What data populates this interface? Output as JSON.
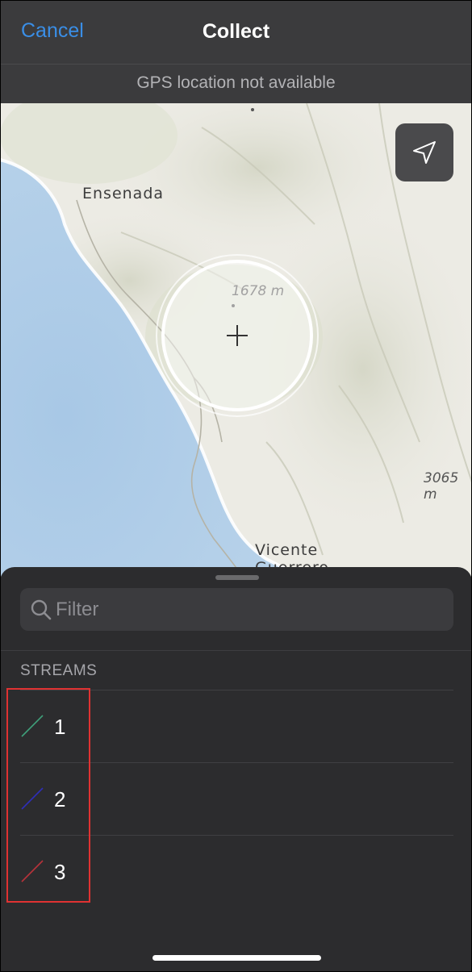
{
  "navbar": {
    "cancel_label": "Cancel",
    "title": "Collect"
  },
  "gps_status": "GPS location not available",
  "map": {
    "place_labels": {
      "ensenada": "Ensenada",
      "vicente": "Vicente",
      "guerrero": "Guerrero"
    },
    "elevation_labels": {
      "peak_center": "1678 m",
      "peak_right": "3065 m"
    }
  },
  "search": {
    "placeholder": "Filter",
    "value": ""
  },
  "section_header": "STREAMS",
  "streams": [
    {
      "label": "1",
      "color": "#3fa07a"
    },
    {
      "label": "2",
      "color": "#2e2eb8"
    },
    {
      "label": "3",
      "color": "#b8323a"
    }
  ],
  "colors": {
    "accent": "#3a8ee6",
    "highlight_box": "#e03232",
    "sheet_background": "#2c2c2e"
  },
  "icons": {
    "locate": "location-arrow-icon",
    "search": "magnifier-icon",
    "reticle": "crosshair-icon"
  }
}
